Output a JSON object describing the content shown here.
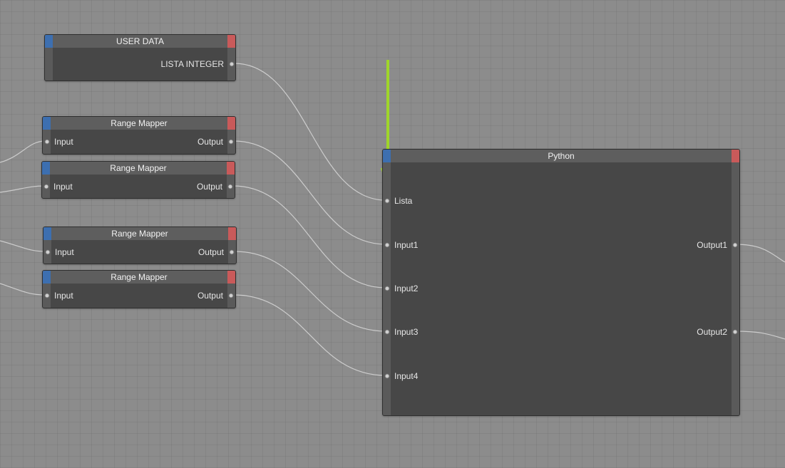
{
  "colors": {
    "canvas": "#8c8c8c",
    "node_body": "#474747",
    "node_header": "#5e5e5e",
    "input_tab": "#3d6fb0",
    "output_tab": "#c95a5a",
    "wire": "#d4d4d4",
    "arrow": "#9fd52a"
  },
  "user_data_node": {
    "title": "USER DATA",
    "output_label": "LISTA INTEGER"
  },
  "range_mappers": [
    {
      "title": "Range Mapper",
      "input_label": "Input",
      "output_label": "Output"
    },
    {
      "title": "Range Mapper",
      "input_label": "Input",
      "output_label": "Output"
    },
    {
      "title": "Range Mapper",
      "input_label": "Input",
      "output_label": "Output"
    },
    {
      "title": "Range Mapper",
      "input_label": "Input",
      "output_label": "Output"
    }
  ],
  "python_node": {
    "title": "Python",
    "inputs": [
      "Lista",
      "Input1",
      "Input2",
      "Input3",
      "Input4"
    ],
    "outputs": [
      "Output1",
      "Output2"
    ]
  },
  "annotation": {
    "icon": "arrow-down-icon"
  }
}
